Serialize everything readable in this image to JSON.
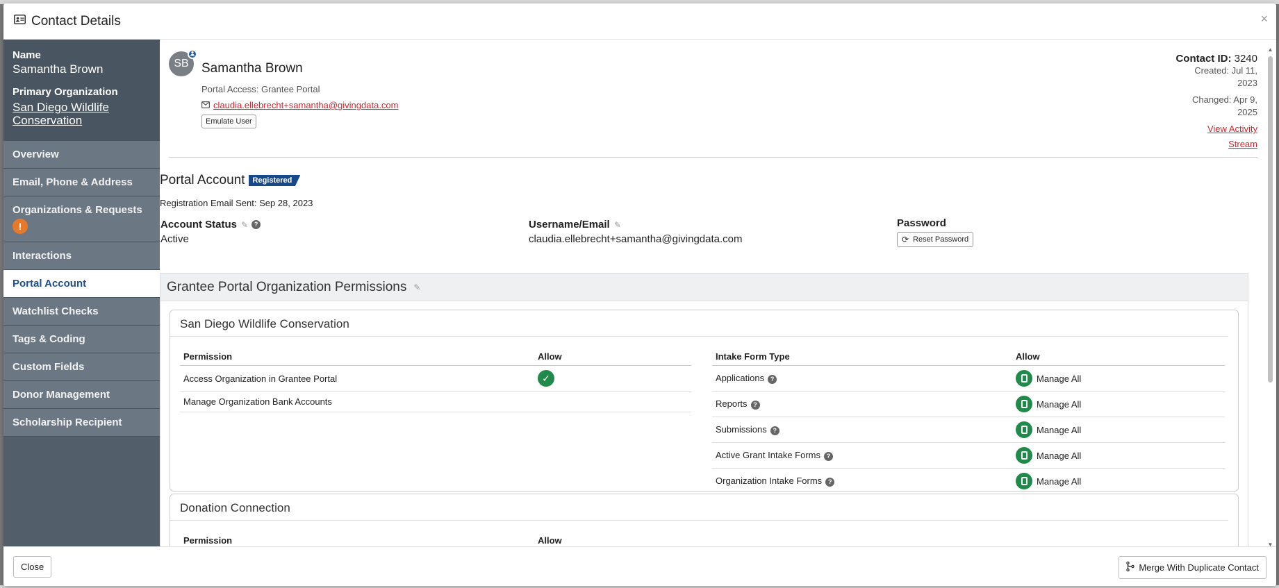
{
  "modal": {
    "title": "Contact Details",
    "close_glyph": "×"
  },
  "sidebar": {
    "name_label": "Name",
    "name_value": "Samantha Brown",
    "org_label": "Primary Organization",
    "org_value": "San Diego Wildlife Conservation",
    "items": [
      {
        "label": "Overview"
      },
      {
        "label": "Email, Phone & Address"
      },
      {
        "label": "Organizations & Requests",
        "badge": "!"
      },
      {
        "label": "Interactions"
      },
      {
        "label": "Portal Account",
        "active": true
      },
      {
        "label": "Watchlist Checks"
      },
      {
        "label": "Tags & Coding"
      },
      {
        "label": "Custom Fields"
      },
      {
        "label": "Donor Management"
      },
      {
        "label": "Scholarship Recipient"
      }
    ]
  },
  "profile": {
    "initials": "SB",
    "name": "Samantha Brown",
    "portal_access": "Portal Access: Grantee Portal",
    "email": "claudia.ellebrecht+samantha@givingdata.com",
    "emulate_label": "Emulate User",
    "contact_id_label": "Contact ID:",
    "contact_id": "3240",
    "created_line1": "Created: Jul 11,",
    "created_line2": "2023",
    "changed_line1": "Changed: Apr 9,",
    "changed_line2": "2025",
    "view_activity_line1": "View Activity",
    "view_activity_line2": "Stream"
  },
  "portal_account": {
    "title": "Portal Account",
    "badge": "Registered",
    "registration_sent": "Registration Email Sent: Sep 28, 2023",
    "account_status_label": "Account Status",
    "account_status_value": "Active",
    "username_label": "Username/Email",
    "username_value": "claudia.ellebrecht+samantha@givingdata.com",
    "password_label": "Password",
    "reset_label": "Reset Password"
  },
  "permissions": {
    "title": "Grantee Portal Organization Permissions",
    "org_card": {
      "title": "San Diego Wildlife Conservation",
      "left_headers": [
        "Permission",
        "Allow"
      ],
      "left_rows": [
        {
          "permission": "Access Organization in Grantee Portal",
          "allowed": true
        },
        {
          "permission": "Manage Organization Bank Accounts",
          "allowed": false
        }
      ],
      "right_headers": [
        "Intake Form Type",
        "Allow"
      ],
      "right_rows": [
        {
          "type": "Applications",
          "allow": "Manage All"
        },
        {
          "type": "Reports",
          "allow": "Manage All"
        },
        {
          "type": "Submissions",
          "allow": "Manage All"
        },
        {
          "type": "Active Grant Intake Forms",
          "allow": "Manage All"
        },
        {
          "type": "Organization Intake Forms",
          "allow": "Manage All"
        }
      ]
    },
    "donation_card": {
      "title": "Donation Connection",
      "headers": [
        "Permission",
        "Allow"
      ]
    }
  },
  "footer": {
    "close_label": "Close",
    "merge_label": "Merge With Duplicate Contact"
  },
  "colors": {
    "accent_red": "#d9232d",
    "nav_active": "#1f4f8a",
    "badge_blue": "#17498a",
    "success_green": "#1f8a4a",
    "warn_orange": "#e8782a"
  }
}
